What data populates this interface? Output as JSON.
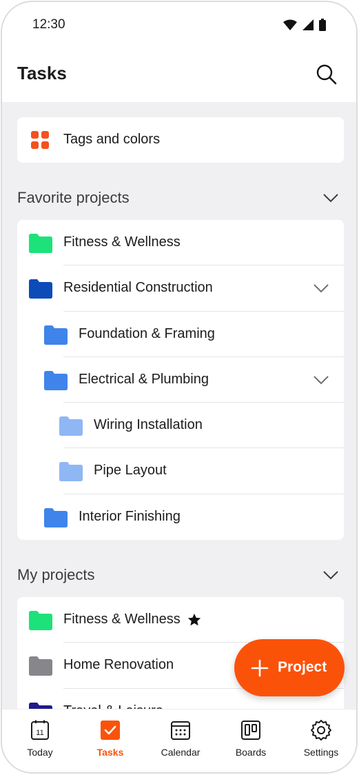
{
  "status_bar": {
    "time": "12:30"
  },
  "app_bar": {
    "title": "Tasks",
    "search_icon": "search-icon"
  },
  "tags_card": {
    "label": "Tags and colors",
    "icon": "tags-grid-icon",
    "icon_color": "#f4511e"
  },
  "favorite_projects": {
    "title": "Favorite projects",
    "items": [
      {
        "label": "Fitness & Wellness",
        "color": "#1de27a",
        "level": 0,
        "expandable": false
      },
      {
        "label": "Residential Construction",
        "color": "#0d4bb8",
        "level": 0,
        "expandable": true
      },
      {
        "label": "Foundation & Framing",
        "color": "#3f84ea",
        "level": 1,
        "expandable": false
      },
      {
        "label": "Electrical & Plumbing",
        "color": "#3f84ea",
        "level": 1,
        "expandable": true
      },
      {
        "label": "Wiring Installation",
        "color": "#8fb7f3",
        "level": 2,
        "expandable": false
      },
      {
        "label": "Pipe Layout",
        "color": "#8fb7f3",
        "level": 2,
        "expandable": false
      },
      {
        "label": "Interior Finishing",
        "color": "#3f84ea",
        "level": 1,
        "expandable": false
      }
    ]
  },
  "my_projects": {
    "title": "My projects",
    "items": [
      {
        "label": "Fitness & Wellness",
        "color": "#1de27a",
        "starred": true
      },
      {
        "label": "Home Renovation",
        "color": "#86868b",
        "starred": false
      },
      {
        "label": "Travel & Leisure",
        "color": "#1f1a8c",
        "starred": false
      }
    ]
  },
  "fab": {
    "label": "Project",
    "color": "#fb520a"
  },
  "bottom_nav": {
    "items": [
      {
        "label": "Today",
        "icon": "calendar-day-icon",
        "day": "11",
        "active": false
      },
      {
        "label": "Tasks",
        "icon": "check-square-icon",
        "active": true
      },
      {
        "label": "Calendar",
        "icon": "calendar-grid-icon",
        "active": false
      },
      {
        "label": "Boards",
        "icon": "board-columns-icon",
        "active": false
      },
      {
        "label": "Settings",
        "icon": "gear-icon",
        "active": false
      }
    ]
  },
  "accent_color": "#fb520a"
}
